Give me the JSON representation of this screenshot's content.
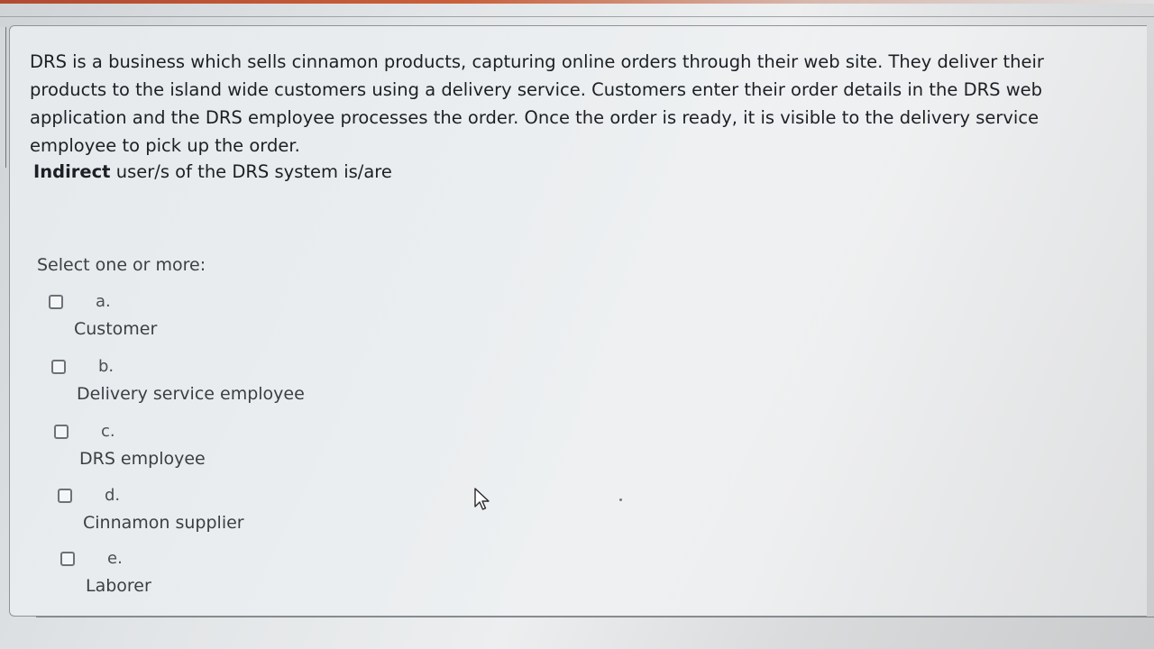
{
  "question": {
    "text": "DRS is a business which sells cinnamon products, capturing online orders through their web site. They deliver their products to the island wide customers using a delivery service. Customers enter their order details in the DRS web application and the DRS employee processes the order. Once the order is ready, it is visible to the delivery service employee to pick up the order.",
    "prompt_bold": "Indirect",
    "prompt_rest": " user/s of the DRS system is/are"
  },
  "select_hint": "Select one or more:",
  "options": [
    {
      "letter": "a.",
      "label": "Customer",
      "checked": false
    },
    {
      "letter": "b.",
      "label": "Delivery service employee",
      "checked": false
    },
    {
      "letter": "c.",
      "label": "DRS employee",
      "checked": false
    },
    {
      "letter": "d.",
      "label": "Cinnamon supplier",
      "checked": false
    },
    {
      "letter": "e.",
      "label": "Laborer",
      "checked": false
    }
  ],
  "colors": {
    "accent_strip": "#c9603a",
    "text": "#1c2024",
    "checkbox_border": "#6c7276"
  }
}
